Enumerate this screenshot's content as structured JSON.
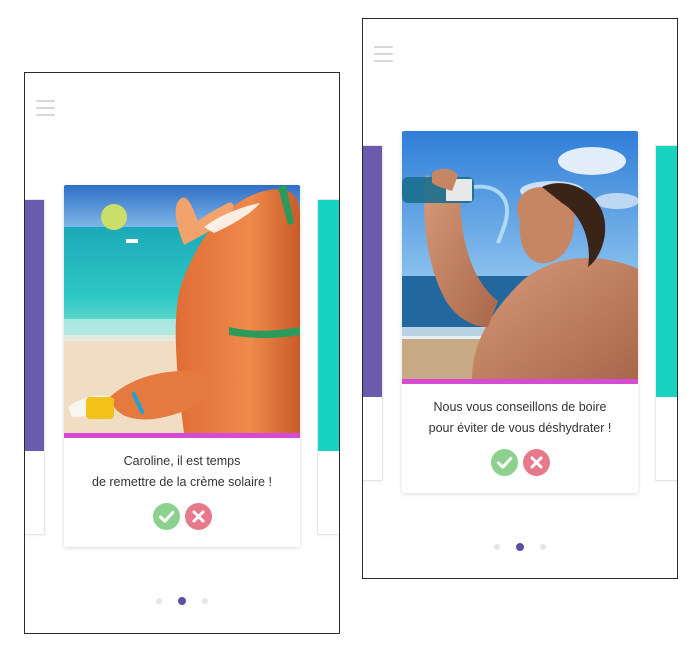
{
  "colors": {
    "purple": "#6a5bad",
    "teal": "#17d4c0",
    "magenta_strip": "#d54bd3",
    "accept_green": "#8dd18e",
    "reject_pink": "#e67a8b",
    "dot_active": "#5b4fa3",
    "dot_inactive": "#e6e6e6"
  },
  "screens": [
    {
      "card": {
        "photo": "beach-sunscreen-photo",
        "message_line1": "Caroline, il est temps",
        "message_line2": "de remettre de la crème solaire !",
        "accept_icon": "check-icon",
        "reject_icon": "close-icon"
      },
      "pagination": {
        "count": 3,
        "active": 2
      }
    },
    {
      "card": {
        "photo": "man-drinking-water-photo",
        "message_line1": "Nous vous conseillons de boire",
        "message_line2": "pour éviter de vous déshydrater !",
        "accept_icon": "check-icon",
        "reject_icon": "close-icon"
      },
      "pagination": {
        "count": 3,
        "active": 2
      }
    }
  ]
}
